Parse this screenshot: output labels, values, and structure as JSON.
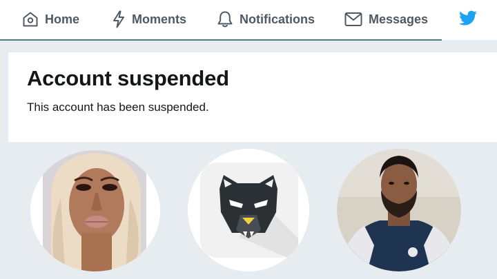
{
  "nav": {
    "items": [
      {
        "label": "Home",
        "icon": "home-icon"
      },
      {
        "label": "Moments",
        "icon": "lightning-icon"
      },
      {
        "label": "Notifications",
        "icon": "bell-icon"
      },
      {
        "label": "Messages",
        "icon": "envelope-icon"
      }
    ],
    "brand_icon": "twitter-bird-icon",
    "brand_color": "#1da1f2",
    "text_color": "#4f5963",
    "active_underline_color": "#4a7f86"
  },
  "notice": {
    "title": "Account suspended",
    "message": "This account has been suspended."
  },
  "avatars": [
    {
      "icon": "woman-avatar"
    },
    {
      "icon": "panther-app-avatar"
    },
    {
      "icon": "man-avatar"
    }
  ],
  "colors": {
    "page_background": "#e6ecf0",
    "card_background": "#ffffff"
  }
}
